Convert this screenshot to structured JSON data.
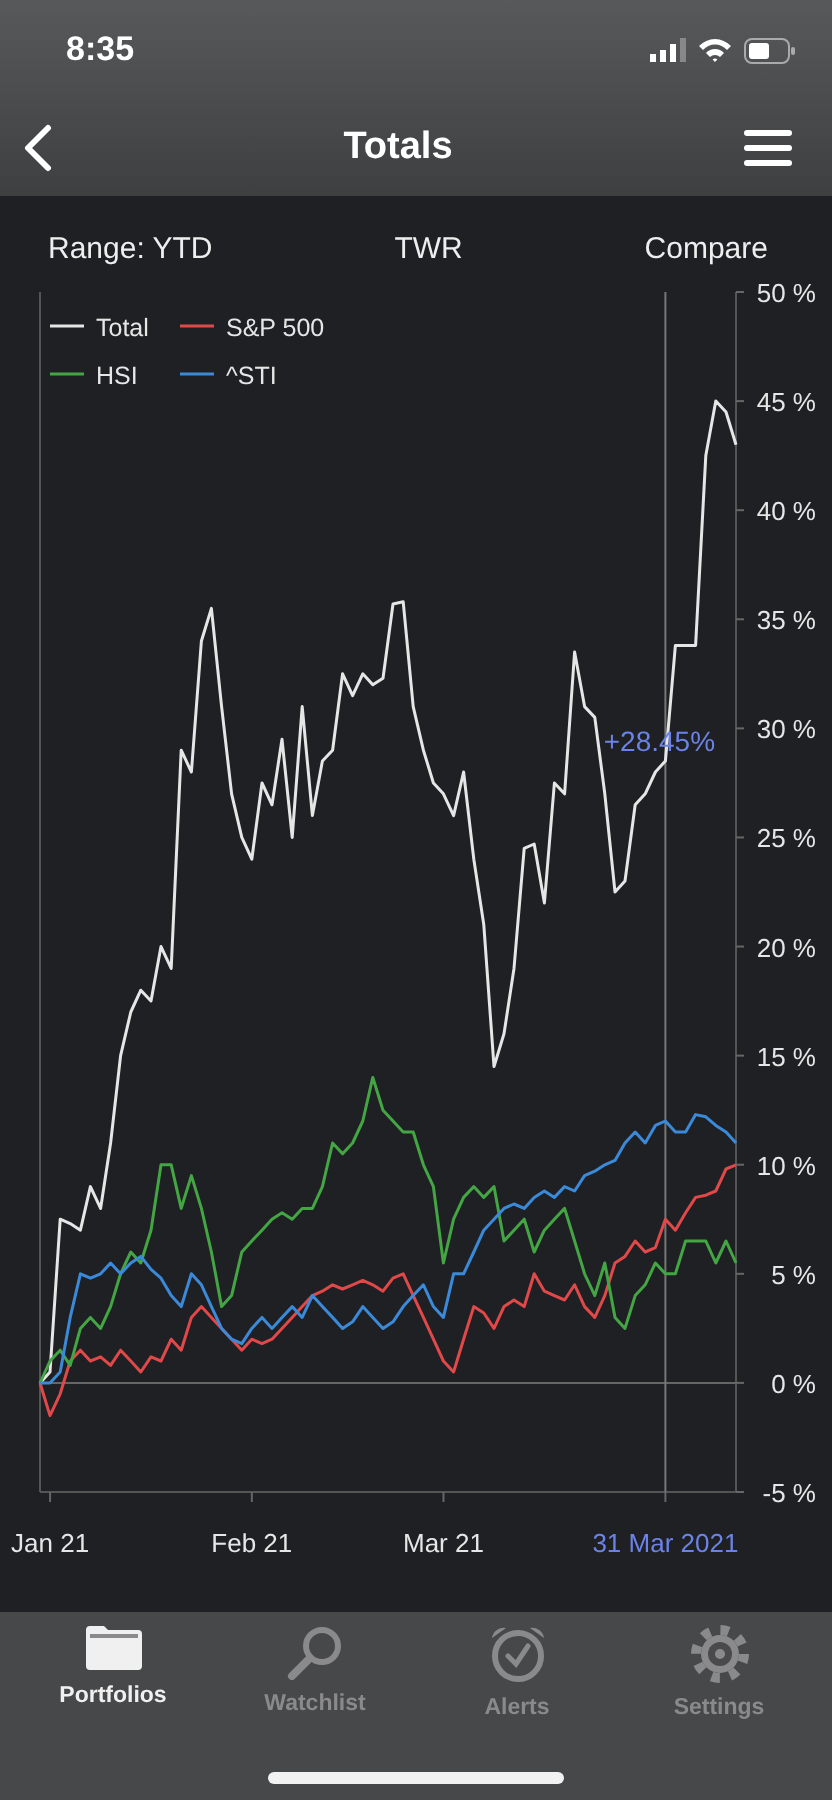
{
  "status_bar": {
    "time": "8:35"
  },
  "nav": {
    "title": "Totals"
  },
  "controls": [
    {
      "label": "Range: YTD"
    },
    {
      "label": "TWR"
    },
    {
      "label": "Compare"
    }
  ],
  "chart": {
    "crosshair": {
      "value_label": "+28.45%",
      "date_label": "31 Mar 2021"
    },
    "chart_data": {
      "type": "line",
      "legend": "upper left",
      "categories": [
        null,
        "Jan 21",
        null,
        null,
        null,
        null,
        null,
        null,
        null,
        null,
        null,
        null,
        null,
        null,
        null,
        null,
        null,
        null,
        null,
        null,
        null,
        "Feb 21",
        null,
        null,
        null,
        null,
        null,
        null,
        null,
        null,
        null,
        null,
        null,
        null,
        null,
        null,
        null,
        null,
        null,
        null,
        "Mar 21",
        null,
        null,
        null,
        null,
        null,
        null,
        null,
        null,
        null,
        null,
        null,
        null,
        null,
        null,
        null,
        null,
        null,
        null,
        null,
        null,
        null,
        null,
        null,
        null,
        null,
        null,
        null,
        null,
        null
      ],
      "ylim": [
        -5,
        50
      ],
      "yticks": [
        {
          "value": -5,
          "label": "-5 %"
        },
        {
          "value": 0,
          "label": "0 %"
        },
        {
          "value": 5,
          "label": "5 %"
        },
        {
          "value": 10,
          "label": "10 %"
        },
        {
          "value": 15,
          "label": "15 %"
        },
        {
          "value": 20,
          "label": "20 %"
        },
        {
          "value": 25,
          "label": "25 %"
        },
        {
          "value": 30,
          "label": "30 %"
        },
        {
          "value": 35,
          "label": "35 %"
        },
        {
          "value": 40,
          "label": "40 %"
        },
        {
          "value": 45,
          "label": "45 %"
        },
        {
          "value": 50,
          "label": "50 %"
        }
      ],
      "series": [
        {
          "name": "Total",
          "color": "#e6e6e6",
          "values": [
            0,
            0.5,
            7.5,
            7.3,
            7,
            9,
            8,
            11,
            15,
            17,
            18,
            17.5,
            20,
            19,
            29,
            28,
            34,
            35.5,
            31,
            27,
            25,
            24,
            27.5,
            26.5,
            29.5,
            25,
            31,
            26,
            28.5,
            29,
            32.5,
            31.5,
            32.5,
            32,
            32.3,
            35.7,
            35.8,
            31,
            29,
            27.5,
            27,
            26,
            28,
            24,
            21,
            14.5,
            16,
            19,
            24.5,
            24.7,
            22,
            27.5,
            27,
            33.5,
            31,
            30.5,
            27,
            22.5,
            23,
            26.5,
            27,
            28,
            28.5,
            33.8,
            33.8,
            33.8,
            42.5,
            45,
            44.5,
            43
          ]
        },
        {
          "name": "S&P 500",
          "color": "#e0484a",
          "values": [
            0,
            -1.5,
            -0.5,
            1,
            1.5,
            1,
            1.2,
            0.8,
            1.5,
            1,
            0.5,
            1.2,
            1,
            2,
            1.5,
            3,
            3.5,
            3,
            2.5,
            2,
            1.5,
            2,
            1.8,
            2,
            2.5,
            3,
            3.5,
            4,
            4.2,
            4.5,
            4.3,
            4.5,
            4.7,
            4.5,
            4.2,
            4.8,
            5,
            4,
            3,
            2,
            1,
            0.5,
            2,
            3.5,
            3.2,
            2.5,
            3.5,
            3.8,
            3.5,
            5,
            4.2,
            4,
            3.8,
            4.5,
            3.5,
            3,
            4,
            5.5,
            5.8,
            6.5,
            6,
            6.2,
            7.5,
            7,
            7.8,
            8.5,
            8.6,
            8.8,
            9.8,
            10
          ]
        },
        {
          "name": "HSI",
          "color": "#43a543",
          "values": [
            0,
            1,
            1.5,
            0.8,
            2.5,
            3,
            2.5,
            3.5,
            5,
            6,
            5.5,
            7,
            10,
            10,
            8,
            9.5,
            8,
            6,
            3.5,
            4,
            6,
            6.5,
            7,
            7.5,
            7.8,
            7.5,
            8,
            8,
            9,
            11,
            10.5,
            11,
            12,
            14,
            12.5,
            12,
            11.5,
            11.5,
            10,
            9,
            5.5,
            7.5,
            8.5,
            9,
            8.5,
            9,
            6.5,
            7,
            7.5,
            6,
            7,
            7.5,
            8,
            6.5,
            5,
            4,
            5.5,
            3,
            2.5,
            4,
            4.5,
            5.5,
            5,
            5,
            6.5,
            6.5,
            6.5,
            5.5,
            6.5,
            5.5
          ]
        },
        {
          "name": "^STI",
          "color": "#3b8ad9",
          "values": [
            0,
            0,
            0.5,
            3,
            5,
            4.8,
            5,
            5.5,
            5,
            5.5,
            5.8,
            5.2,
            4.8,
            4,
            3.5,
            5,
            4.5,
            3.5,
            2.5,
            2,
            1.8,
            2.5,
            3,
            2.5,
            3,
            3.5,
            3,
            4,
            3.5,
            3,
            2.5,
            2.8,
            3.5,
            3,
            2.5,
            2.8,
            3.5,
            4,
            4.5,
            3.5,
            3,
            5,
            5,
            6,
            7,
            7.5,
            8,
            8.2,
            8,
            8.5,
            8.8,
            8.5,
            9,
            8.8,
            9.5,
            9.7,
            10,
            10.2,
            11,
            11.5,
            11,
            11.8,
            12,
            11.5,
            11.5,
            12.3,
            12.2,
            11.8,
            11.5,
            11
          ]
        }
      ]
    }
  },
  "tab_bar": [
    {
      "label": "Portfolios",
      "selected": true
    },
    {
      "label": "Watchlist",
      "selected": false
    },
    {
      "label": "Alerts",
      "selected": false
    },
    {
      "label": "Settings",
      "selected": false
    }
  ]
}
